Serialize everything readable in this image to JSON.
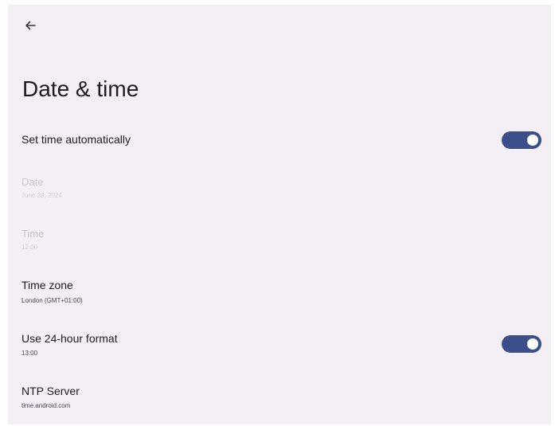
{
  "page": {
    "title": "Date & time"
  },
  "settings": {
    "auto_time": {
      "title": "Set time automatically",
      "enabled": true
    },
    "date": {
      "title": "Date",
      "summary": "June 28, 2024",
      "disabled": true
    },
    "time": {
      "title": "Time",
      "summary": "12:00",
      "disabled": true
    },
    "time_zone": {
      "title": "Time zone",
      "summary": "London (GMT+01:00)"
    },
    "use_24_hour": {
      "title": "Use 24-hour format",
      "summary": "13:00",
      "enabled": true
    },
    "ntp_server": {
      "title": "NTP Server",
      "summary": "time.android.com"
    }
  },
  "icons": {
    "back": "arrow-back-icon"
  },
  "colors": {
    "background": "#f3eff5",
    "toggle_on": "#3c4f8a",
    "text_primary": "#1f1b22",
    "text_disabled": "#c9c5cd"
  }
}
